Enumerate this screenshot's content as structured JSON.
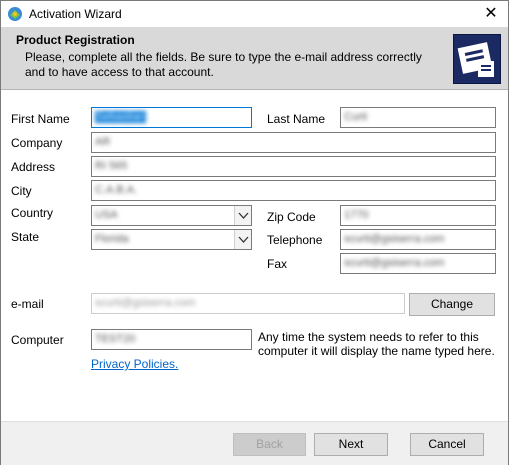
{
  "window": {
    "title": "Activation Wizard"
  },
  "header": {
    "title": "Product Registration",
    "description": "Please, complete all the fields. Be sure to type the e-mail address correctly and to have access to that account."
  },
  "form": {
    "first_name": {
      "label": "First Name",
      "value": "Sebastian"
    },
    "last_name": {
      "label": "Last Name",
      "value": "Curti"
    },
    "company": {
      "label": "Company",
      "value": "AR"
    },
    "address": {
      "label": "Address",
      "value": "RI 565"
    },
    "city": {
      "label": "City",
      "value": "C.A.B.A."
    },
    "country": {
      "label": "Country",
      "value": "USA"
    },
    "state": {
      "label": "State",
      "value": "Florida"
    },
    "zip": {
      "label": "Zip Code",
      "value": "1770"
    },
    "telephone": {
      "label": "Telephone",
      "value": "scurti@gsiserra.com"
    },
    "fax": {
      "label": "Fax",
      "value": "scurti@gsiserra.com"
    },
    "email": {
      "label": "e-mail",
      "value": "scurti@gsiserra.com",
      "change_label": "Change"
    },
    "computer": {
      "label": "Computer",
      "value": "TEST20",
      "note": "Any time the system needs to refer to this computer it will display the name typed here."
    },
    "privacy_link": "Privacy Policies."
  },
  "footer": {
    "back_label": "Back",
    "next_label": "Next",
    "cancel_label": "Cancel"
  },
  "colors": {
    "header_bg": "#d9d9d9",
    "focus": "#0078d7",
    "link": "#0066cc",
    "logo_bg": "#1b2a63"
  }
}
